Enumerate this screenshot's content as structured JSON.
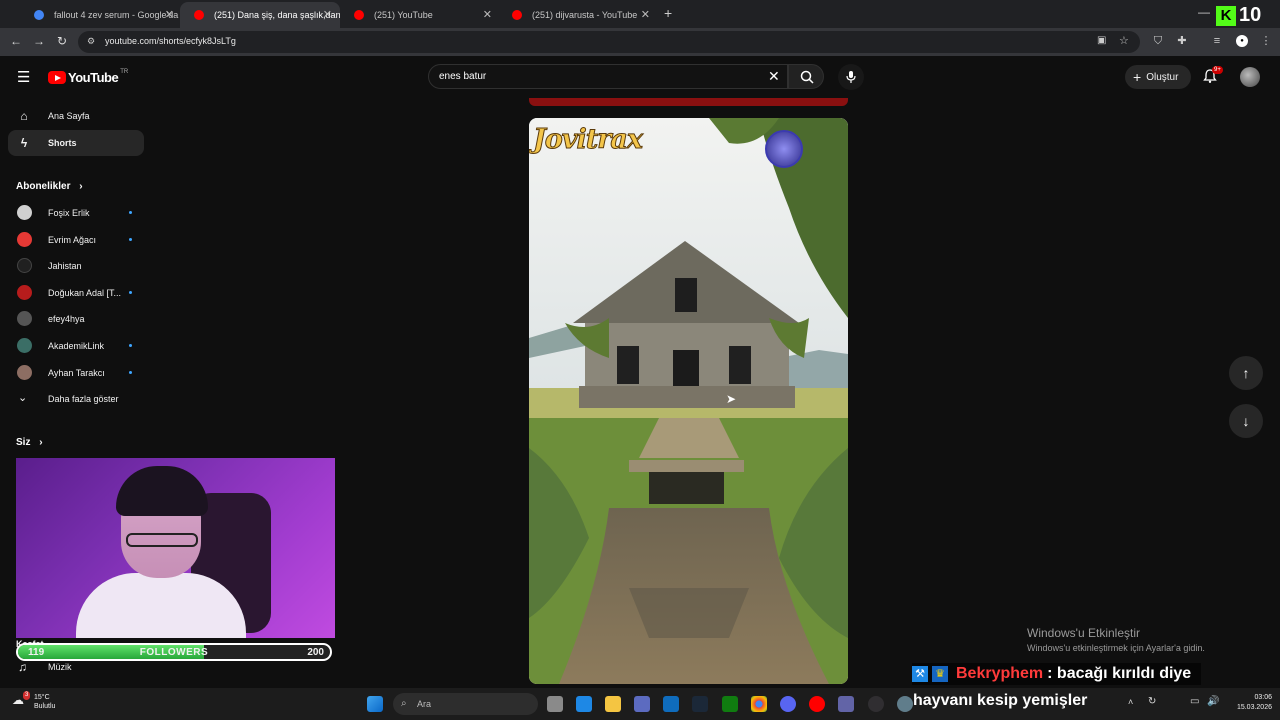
{
  "browser": {
    "tabs": [
      {
        "title": "fallout 4 zev serum - Google'da",
        "favicon_color": "#4285f4",
        "active": false
      },
      {
        "title": "(251) Dana şiş, dana şaşlık,dana",
        "favicon_color": "#ff0000",
        "active": true
      },
      {
        "title": "(251) YouTube",
        "favicon_color": "#ff0000",
        "active": false
      },
      {
        "title": "(251) dijvarusta - YouTube",
        "favicon_color": "#ff0000",
        "active": false
      }
    ],
    "url": "youtube.com/shorts/ecfyk8JsLTg"
  },
  "kick": {
    "letter": "K",
    "count": "10"
  },
  "youtube": {
    "logo_text": "YouTube",
    "logo_region": "TR",
    "search_value": "enes batur",
    "create_label": "Oluştur",
    "notification_count": "9+"
  },
  "sidebar": {
    "main": [
      {
        "label": "Ana Sayfa",
        "icon": "home-icon",
        "selected": false
      },
      {
        "label": "Shorts",
        "icon": "shorts-icon",
        "selected": true
      }
    ],
    "subscriptions_title": "Abonelikler",
    "subscriptions": [
      {
        "name": "Foşix Erlik",
        "color": "#d0d0d0",
        "new": true
      },
      {
        "name": "Evrim Ağacı",
        "color": "#e53935",
        "new": true
      },
      {
        "name": "Jahistan",
        "color": "#202020",
        "new": false
      },
      {
        "name": "Doğukan Adal [T...",
        "color": "#b71c1c",
        "new": true
      },
      {
        "name": "efey4hya",
        "color": "#555555",
        "new": false
      },
      {
        "name": "AkademikLink",
        "color": "#3b6e66",
        "new": true
      },
      {
        "name": "Ayhan Tarakcı",
        "color": "#8d6e63",
        "new": true
      }
    ],
    "show_more": "Daha fazla göster",
    "you_title": "Siz",
    "partial_label": "Keşfet",
    "music_label": "Müzik"
  },
  "followers_widget": {
    "current": "119",
    "label": "FOLLOWERS",
    "goal": "200",
    "progress": 0.595
  },
  "video": {
    "watermark": "Jovitrax"
  },
  "windows_activation": {
    "title": "Windows'u Etkinleştir",
    "subtitle": "Windows'u etkinleştirmek için Ayarlar'a gidin."
  },
  "chat": {
    "username": "Bekryphem",
    "username_color": "#ff3b3b",
    "message_line1": ": bacağı kırıldı diye",
    "message_line2": "hayvanı kesip yemişler"
  },
  "taskbar": {
    "weather_temp": "15°C",
    "weather_desc": "Bulutlu",
    "weather_badge": "3",
    "search_placeholder": "Ara",
    "time": "03:06",
    "date": "15.03.2026"
  }
}
